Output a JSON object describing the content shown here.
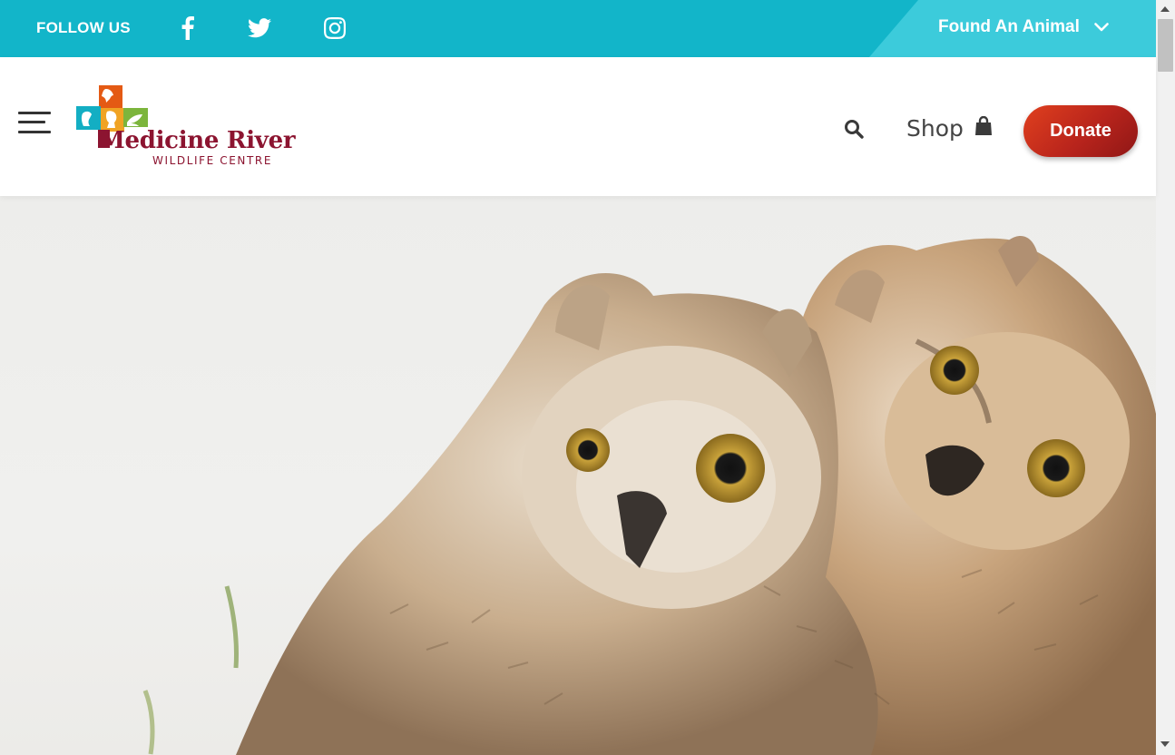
{
  "topbar": {
    "follow_label": "FOLLOW US",
    "social_icons": [
      "facebook-icon",
      "twitter-icon",
      "instagram-icon"
    ],
    "found_animal_label": "Found An Animal"
  },
  "header": {
    "logo": {
      "title": "Medicine River",
      "subtitle": "WILDLIFE CENTRE"
    },
    "shop_label": "Shop",
    "donate_label": "Donate"
  },
  "hero": {
    "image": "owl-fledglings-photo"
  },
  "colors": {
    "topbar": "#12b5c9",
    "found_tab": "#3ccbdb",
    "brand_maroon": "#8c1430",
    "donate_red": "#b8241c"
  }
}
